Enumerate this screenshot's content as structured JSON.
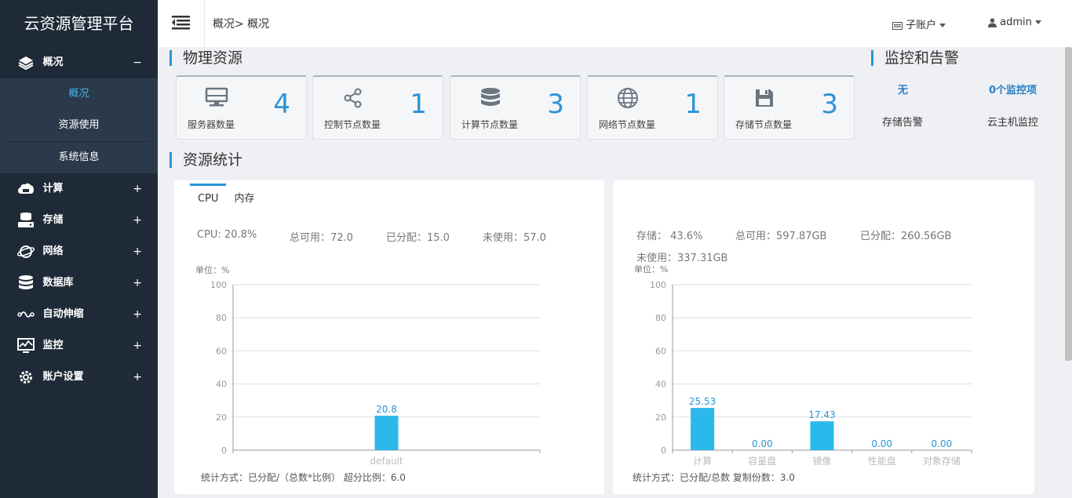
{
  "sidebar": {
    "brand": "云资源管理平台",
    "overview": {
      "label": "概况",
      "sign": "−",
      "subitems": [
        "概况",
        "资源使用",
        "系统信息"
      ]
    },
    "items": [
      {
        "label": "计算",
        "sign": "+",
        "icon": "cloud-compute-icon"
      },
      {
        "label": "存储",
        "sign": "+",
        "icon": "storage-icon"
      },
      {
        "label": "网络",
        "sign": "+",
        "icon": "network-icon"
      },
      {
        "label": "数据库",
        "sign": "+",
        "icon": "database-icon"
      },
      {
        "label": "自动伸缩",
        "sign": "+",
        "icon": "autoscale-icon"
      },
      {
        "label": "监控",
        "sign": "+",
        "icon": "monitor-icon"
      },
      {
        "label": "账户设置",
        "sign": "+",
        "icon": "gear-icon"
      }
    ]
  },
  "header": {
    "breadcrumb": "概况> 概况",
    "sub_account": "子账户",
    "user": "admin"
  },
  "physical": {
    "title": "物理资源",
    "cards": [
      {
        "label": "服务器数量",
        "value": "4"
      },
      {
        "label": "控制节点数量",
        "value": "1"
      },
      {
        "label": "计算节点数量",
        "value": "3"
      },
      {
        "label": "网络节点数量",
        "value": "1"
      },
      {
        "label": "存储节点数量",
        "value": "3"
      }
    ]
  },
  "monitor": {
    "title": "监控和告警",
    "storage_value": "无",
    "storage_label": "存储告警",
    "vm_value": "0个监控项",
    "vm_label": "云主机监控"
  },
  "stats": {
    "title": "资源统计",
    "left": {
      "tabs": [
        "CPU",
        "内存"
      ],
      "cpu": "CPU: 20.8%",
      "total": "总可用：72.0",
      "allocated": "已分配：15.0",
      "unused": "未使用：57.0",
      "unit": "单位：%",
      "footer": "统计方式：已分配/（总数*比例）  超分比例：6.0"
    },
    "right": {
      "storage": "存储： 43.6%",
      "total": "总可用：597.87GB",
      "allocated": "已分配：260.56GB",
      "unused": "未使用：337.31GB",
      "unit": "单位：%",
      "footer": "统计方式：已分配/总数  复制份数：3.0"
    }
  },
  "chart_data": [
    {
      "type": "bar",
      "categories": [
        "default"
      ],
      "values": [
        20.8
      ],
      "data_labels": [
        "20.8"
      ],
      "ylim": [
        0,
        100
      ],
      "yticks": [
        0,
        20,
        40,
        60,
        80,
        100
      ],
      "ylabel": "单位：%",
      "color": "#2bb8ea"
    },
    {
      "type": "bar",
      "categories": [
        "计算",
        "容量盘",
        "镜像",
        "性能盘",
        "对象存储"
      ],
      "values": [
        25.53,
        0,
        17.43,
        0,
        0
      ],
      "data_labels": [
        "25.53",
        "0.00",
        "17.43",
        "0.00",
        "0.00"
      ],
      "ylim": [
        0,
        100
      ],
      "yticks": [
        0,
        20,
        40,
        60,
        80,
        100
      ],
      "ylabel": "单位：%",
      "color": "#2bb8ea"
    }
  ]
}
